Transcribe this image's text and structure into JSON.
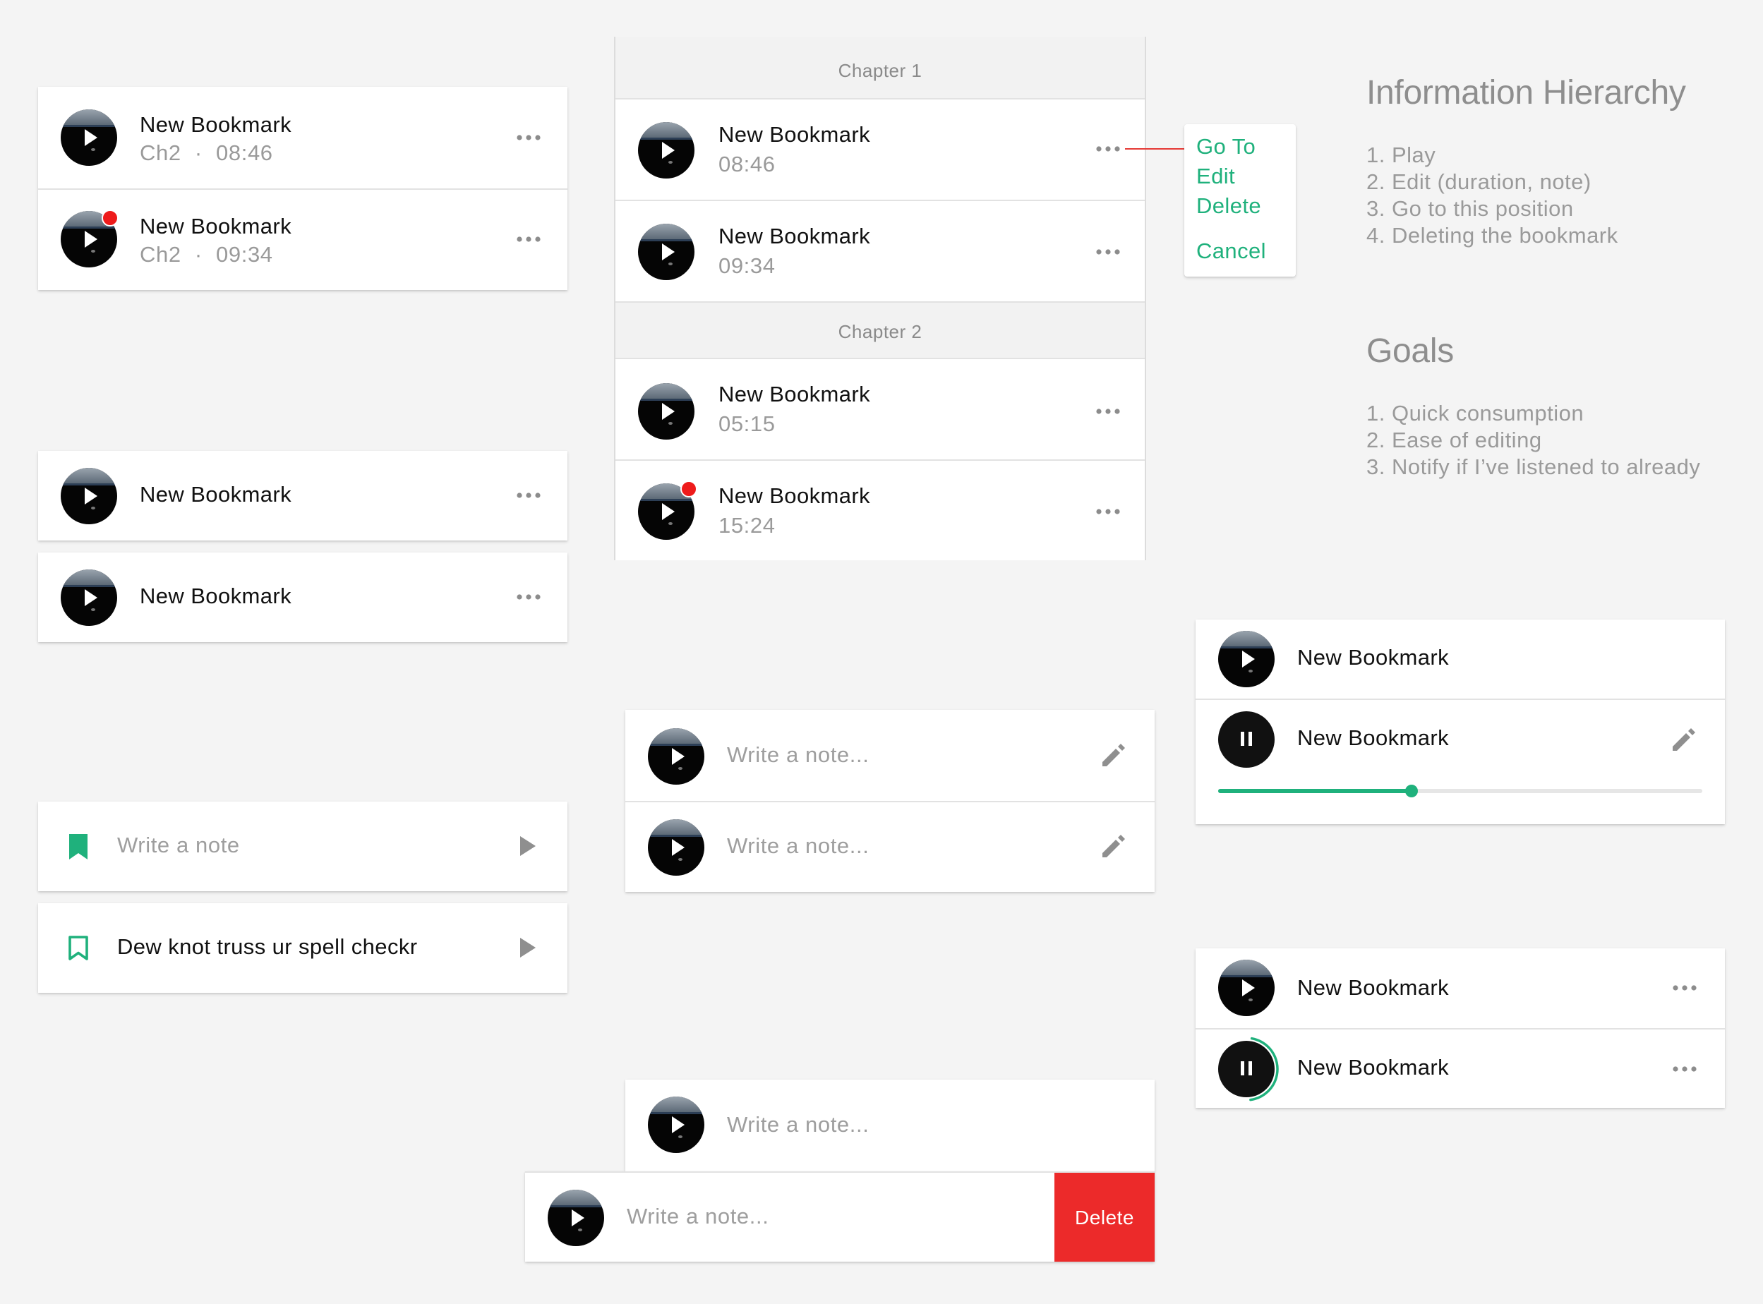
{
  "colors": {
    "accent_green": "#1fb17c",
    "delete_red": "#ec2a2a",
    "unread_dot": "#ee1b1b",
    "background": "#f4f4f4"
  },
  "icons": {
    "play": "play-icon",
    "pause": "pause-icon",
    "more": "more-horizontal-icon",
    "edit": "pencil-icon",
    "bookmark_filled": "bookmark-filled-icon",
    "bookmark_outline": "bookmark-outline-icon",
    "triangle_play": "play-triangle-icon"
  },
  "panel_a": {
    "items": [
      {
        "title": "New Bookmark",
        "chapter": "Ch2",
        "separator": "·",
        "time": "08:46",
        "unread": false
      },
      {
        "title": "New Bookmark",
        "chapter": "Ch2",
        "separator": "·",
        "time": "09:34",
        "unread": true
      }
    ]
  },
  "panel_b": {
    "items": [
      {
        "title": "New Bookmark"
      },
      {
        "title": "New Bookmark"
      }
    ]
  },
  "panel_c": {
    "items": [
      {
        "placeholder": "Write a note",
        "icon": "bookmark-filled-icon"
      },
      {
        "text": "Dew knot truss ur spell checkr",
        "icon": "bookmark-outline-icon"
      }
    ]
  },
  "chapters": [
    {
      "label": "Chapter 1",
      "items": [
        {
          "title": "New Bookmark",
          "time": "08:46",
          "unread": false
        },
        {
          "title": "New Bookmark",
          "time": "09:34",
          "unread": false
        }
      ]
    },
    {
      "label": "Chapter 2",
      "items": [
        {
          "title": "New Bookmark",
          "time": "05:15",
          "unread": false
        },
        {
          "title": "New Bookmark",
          "time": "15:24",
          "unread": true
        }
      ]
    }
  ],
  "context_menu": {
    "items": [
      "Go To",
      "Edit",
      "Delete"
    ],
    "cancel": "Cancel"
  },
  "info": {
    "hierarchy_title": "Information Hierarchy",
    "hierarchy": [
      "1. Play",
      "2. Edit (duration, note)",
      "3. Go to this position",
      "4. Deleting the bookmark"
    ],
    "goals_title": "Goals",
    "goals": [
      "1. Quick consumption",
      "2. Ease of editing",
      "3. Notify if I’ve listened to already"
    ]
  },
  "note_panel": {
    "items": [
      {
        "placeholder": "Write a note..."
      },
      {
        "placeholder": "Write a note..."
      }
    ]
  },
  "swipe_panel": {
    "top": {
      "placeholder": "Write a note..."
    },
    "swiped": {
      "placeholder": "Write a note...",
      "delete_label": "Delete"
    }
  },
  "player_panel": {
    "items": [
      {
        "title": "New Bookmark",
        "state": "paused"
      },
      {
        "title": "New Bookmark",
        "state": "playing",
        "progress": 0.4
      }
    ]
  },
  "ring_panel": {
    "items": [
      {
        "title": "New Bookmark",
        "state": "paused"
      },
      {
        "title": "New Bookmark",
        "state": "playing",
        "ring_progress": 0.45
      }
    ]
  }
}
